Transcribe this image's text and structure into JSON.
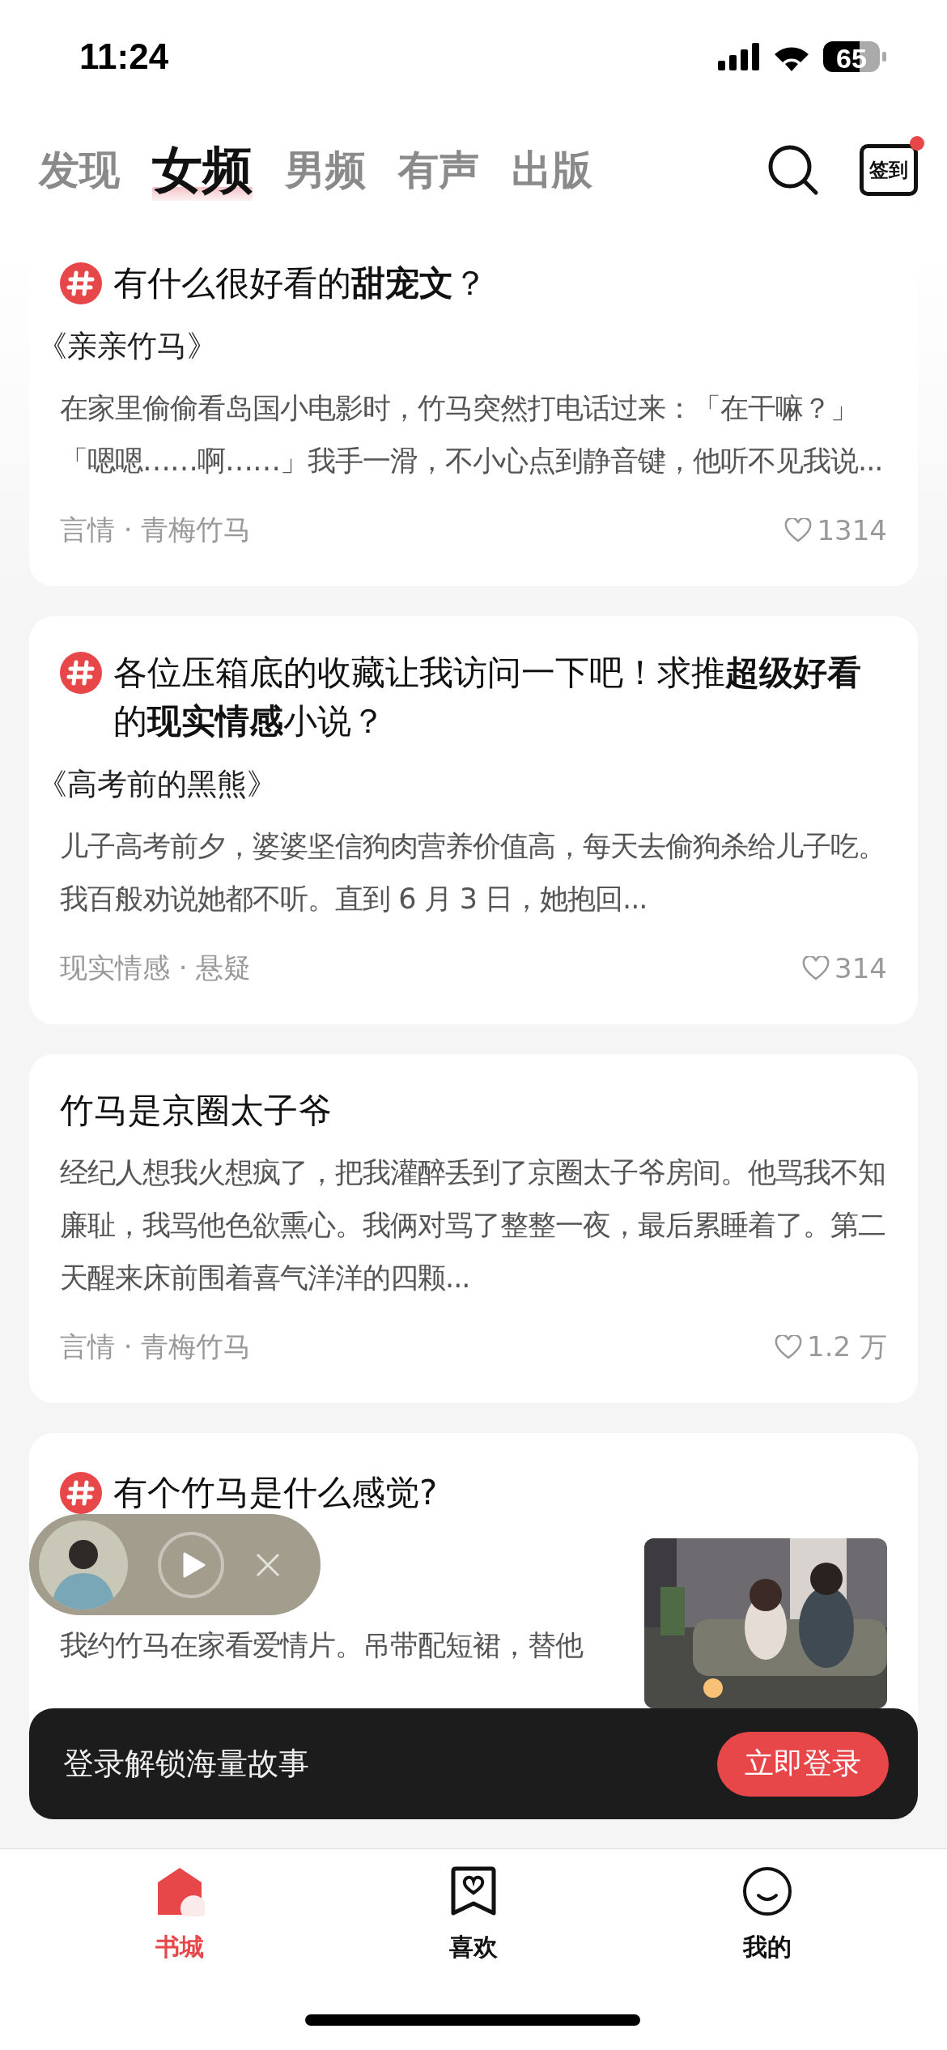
{
  "status_bar": {
    "time": "11:24",
    "battery": "65"
  },
  "tabs": [
    {
      "label": "发现",
      "selected": false
    },
    {
      "label": "女频",
      "selected": true
    },
    {
      "label": "男频",
      "selected": false
    },
    {
      "label": "有声",
      "selected": false
    },
    {
      "label": "出版",
      "selected": false
    }
  ],
  "checkin": {
    "label": "签到",
    "badge": true
  },
  "cards": [
    {
      "topic": true,
      "title": "有什么很好看的**甜宠文**？",
      "book": "《亲亲竹马》",
      "excerpt": "在家里偷偷看岛国小电影时，竹马突然打电话过来：「在干嘛？」「嗯嗯……啊……」我手一滑，不小心点到静音键，他听不见我说...",
      "tags": "言情 · 青梅竹马",
      "likes": "1314"
    },
    {
      "topic": true,
      "title": "各位压箱底的收藏让我访问一下吧！求推**超级好看**的**现实情感**小说？",
      "book": "《高考前的黑熊》",
      "excerpt": "儿子高考前夕，婆婆坚信狗肉营养价值高，每天去偷狗杀给儿子吃。我百般劝说她都不听。直到 6 月 3 日，她抱回...",
      "tags": "现实情感 · 悬疑",
      "likes": "314"
    },
    {
      "topic": false,
      "title": "竹马是京圈太子爷",
      "excerpt": "经纪人想我火想疯了，把我灌醉丢到了京圈太子爷房间。他骂我不知廉耻，我骂他色欲熏心。我俩对骂了整整一夜，最后累睡着了。第二天醒来床前围着喜气洋洋的四颗...",
      "tags": "言情 · 青梅竹马",
      "likes": "1.2 万"
    },
    {
      "topic": true,
      "title": "有个竹马是什么感觉?",
      "excerpt": "我约竹马在家看爱情片。吊带配短裙，替他",
      "kind": "picture"
    }
  ],
  "mini_player": {
    "playing": false
  },
  "login_bar": {
    "text": "登录解锁海量故事",
    "button": "立即登录"
  },
  "bottom_nav": [
    {
      "label": "书城",
      "selected": true
    },
    {
      "label": "喜欢",
      "selected": false
    },
    {
      "label": "我的",
      "selected": false
    }
  ]
}
